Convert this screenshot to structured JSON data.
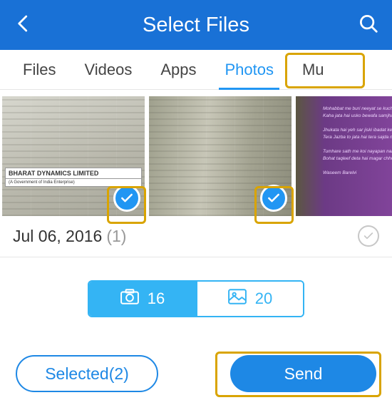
{
  "header": {
    "title": "Select Files"
  },
  "tabs": {
    "items": [
      "Files",
      "Videos",
      "Apps",
      "Photos",
      "Mu"
    ],
    "active_index": 3
  },
  "thumbs": {
    "t1_label1": "BHARAT DYNAMICS LIMITED",
    "t1_label2": "(A Government of India Enterprise)",
    "t3_lines": [
      "Mohabbat me buri neeyat se kuch socha nahi jata",
      "Kaha jata hai usko bewafa samjha nahi jata",
      "Jhukata hai yeh sar jiski ibadat ke liye us ko",
      "Tera Jazba to jata hai tera sajda nahi jata",
      "Tumhare sath me koi nayapan nahi to bas yeh",
      "Bohat taqleef deta hai magar chhora nahi jata",
      "Waseem Barelvi"
    ]
  },
  "date_section": {
    "date": "Jul 06, 2016",
    "count": "(1)"
  },
  "counters": {
    "camera": "16",
    "gallery": "20"
  },
  "bottom": {
    "selected": "Selected(2)",
    "send": "Send"
  },
  "colors": {
    "primary": "#1e88e5",
    "highlight": "#d9a400"
  }
}
